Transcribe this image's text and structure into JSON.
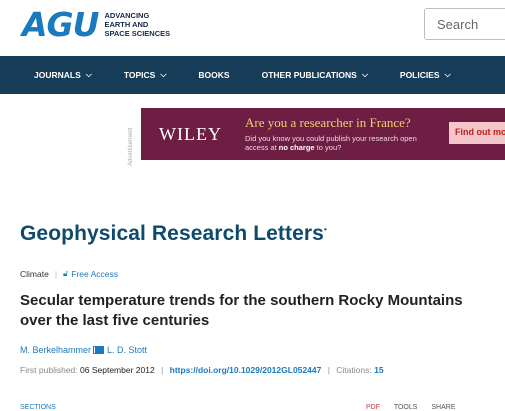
{
  "header": {
    "logo_mark": "AGU",
    "logo_lines": [
      "ADVANCING",
      "EARTH AND",
      "SPACE SCIENCES"
    ],
    "search_placeholder": "Search"
  },
  "nav": {
    "items": [
      {
        "label": "JOURNALS",
        "has_dropdown": true
      },
      {
        "label": "TOPICS",
        "has_dropdown": true
      },
      {
        "label": "BOOKS",
        "has_dropdown": false
      },
      {
        "label": "OTHER PUBLICATIONS",
        "has_dropdown": true
      },
      {
        "label": "POLICIES",
        "has_dropdown": true
      }
    ]
  },
  "ad": {
    "label": "Advertisement",
    "brand": "WILEY",
    "headline": "Are you a researcher in France?",
    "body_prefix": "Did you know you could publish your research open access at ",
    "body_bold": "no charge",
    "body_suffix": " to you?",
    "cta": "Find out more",
    "colors": {
      "background": "#6e1e43",
      "headline": "#f1d06f",
      "cta_bg": "#f4c6c9"
    }
  },
  "journal": {
    "title": "Geophysical Research Letters"
  },
  "article": {
    "category": "Climate",
    "access": "Free Access",
    "title": "Secular temperature trends for the southern Rocky Mountains over the last five centuries",
    "authors": [
      "M. Berkelhammer",
      "L. D. Stott"
    ],
    "first_published_label": "First published:",
    "first_published_date": "06 September 2012",
    "doi": "https://doi.org/10.1029/2012GL052447",
    "citations_label": "Citations:",
    "citations": "15"
  },
  "toolbar": {
    "sections": "SECTIONS",
    "pdf": "PDF",
    "tools": "TOOLS",
    "share": "SHARE"
  }
}
